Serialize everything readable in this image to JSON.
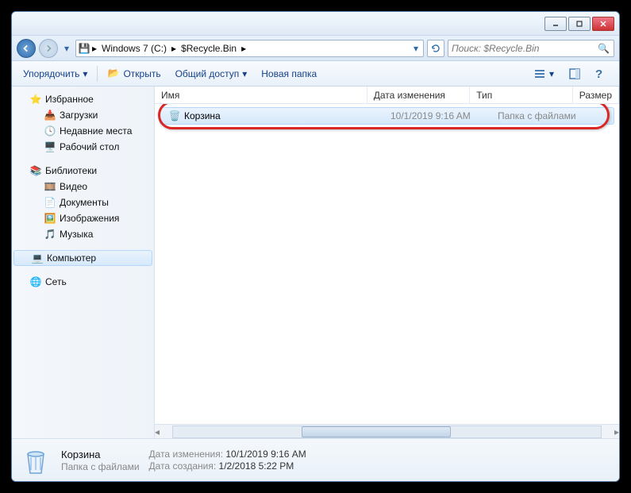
{
  "breadcrumbs": {
    "seg1": "Windows 7 (C:)",
    "seg2": "$Recycle.Bin"
  },
  "search": {
    "placeholder": "Поиск: $Recycle.Bin"
  },
  "toolbar": {
    "organize": "Упорядочить",
    "open": "Открыть",
    "share": "Общий доступ",
    "newfolder": "Новая папка"
  },
  "sidebar": {
    "favorites": "Избранное",
    "downloads": "Загрузки",
    "recent": "Недавние места",
    "desktop": "Рабочий стол",
    "libraries": "Библиотеки",
    "videos": "Видео",
    "documents": "Документы",
    "pictures": "Изображения",
    "music": "Музыка",
    "computer": "Компьютер",
    "network": "Сеть"
  },
  "columns": {
    "name": "Имя",
    "date": "Дата изменения",
    "type": "Тип",
    "size": "Размер"
  },
  "files": [
    {
      "name": "Корзина",
      "date": "10/1/2019 9:16 AM",
      "type": "Папка с файлами"
    }
  ],
  "details": {
    "name": "Корзина",
    "type": "Папка с файлами",
    "modlabel": "Дата изменения:",
    "modval": "10/1/2019 9:16 AM",
    "crtlabel": "Дата создания:",
    "crtval": "1/2/2018 5:22 PM"
  }
}
